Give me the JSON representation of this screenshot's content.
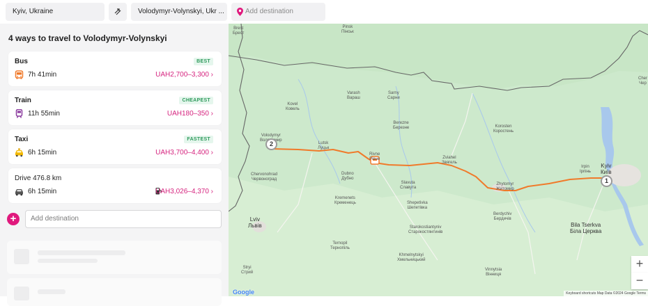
{
  "search": {
    "origin": "Kyiv, Ukraine",
    "destination": "Volodymyr-Volynskyi, Ukr ...",
    "add_destination_placeholder": "Add destination"
  },
  "sidebar": {
    "title": "4 ways to travel to Volodymyr-Volynskyi",
    "options": [
      {
        "mode": "Bus",
        "badge": "BEST",
        "duration": "7h 41min",
        "price": "UAH2,700–3,300 ›",
        "icon": "bus-icon"
      },
      {
        "mode": "Train",
        "badge": "CHEAPEST",
        "duration": "11h 55min",
        "price": "UAH180–350 ›",
        "icon": "train-icon"
      },
      {
        "mode": "Taxi",
        "badge": "FASTEST",
        "duration": "6h 15min",
        "price": "UAH3,700–4,400 ›",
        "icon": "taxi-icon"
      },
      {
        "mode": "Drive 476.8 km",
        "badge": "",
        "duration": "6h 15min",
        "price": "UAH3,026–4,370 ›",
        "icon": "car-icon"
      }
    ],
    "add_destination_placeholder": "Add destination"
  },
  "map": {
    "labels": {
      "brest": "Brest\nБрест",
      "pinsk": "Pinsk\nПінськ",
      "varash": "Varash\nВараш",
      "sarny": "Sarny\nСарни",
      "kovel": "Kovel\nКовель",
      "berezne": "Berezne\nБерезне",
      "korosten": "Korosten\nКоростень",
      "volodymyr": "Volodymyr\nВолодимир",
      "lutsk": "Lutsk\nЛуцьк",
      "rivne": "Rivne\nРівне",
      "zviahel": "Zviahel\nЗвягель",
      "irpin": "Irpin\nІрпінь",
      "kyiv": "Kyiv\nКиїв",
      "chervonohrad": "Chervonohrad\nЧервоноград",
      "dubno": "Dubno\nДубно",
      "slavuta": "Slavuta\nСлавута",
      "zhytomyr": "Zhytomyr\nЖитомир",
      "kremenets": "Kremenets\nКременець",
      "shepetivka": "Shepetivka\nШепетівка",
      "berdychiv": "Berdychiv\nБердичів",
      "lviv": "Lviv\nЛьвів",
      "starokostiantyniv": "Starokostiantyniv\nСтарокостянтинів",
      "bila_tserkva": "Bila Tserkva\nБіла Церква",
      "ternopil": "Ternopil\nТернопіль",
      "khmelnytskyi": "Khmelnytskyi\nХмельницький",
      "stryi": "Stryi\nСтрий",
      "vinnytsia": "Vinnytsia\nВінниця",
      "chernihiv_partial": "Cher\nЧер"
    },
    "markers": {
      "start": "1",
      "end": "2"
    },
    "zoom_in": "+",
    "zoom_out": "−",
    "attribution": "Keyboard shortcuts   Map Data ©2024 Google   Terms",
    "logo": "Google",
    "colors": {
      "route": "#f07a2a",
      "land": "#cde9cc",
      "water": "#a8c8ec",
      "accent": "#e0197d"
    }
  }
}
